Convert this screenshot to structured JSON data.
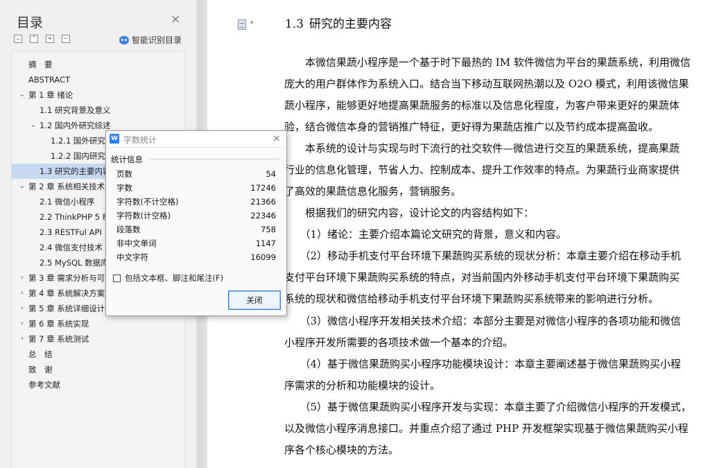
{
  "nav": {
    "title": "目录",
    "close_glyph": "×",
    "tool_glyphs": [
      "⌄",
      "⌃",
      "+",
      "−"
    ],
    "smart_toc_label": "智能识别目录",
    "items": [
      {
        "label": "摘　要",
        "level": 0,
        "expand": "",
        "selected": false
      },
      {
        "label": "ABSTRACT",
        "level": 0,
        "expand": "",
        "selected": false
      },
      {
        "label": "第 1 章  绪论",
        "level": 0,
        "expand": "open",
        "selected": false
      },
      {
        "label": "1.1  研究背景及意义",
        "level": 1,
        "expand": "",
        "selected": false
      },
      {
        "label": "1.2  国内外研究综述",
        "level": 1,
        "expand": "open",
        "selected": false
      },
      {
        "label": "1.2.1 国外研究现状",
        "level": 2,
        "expand": "",
        "selected": false
      },
      {
        "label": "1.2.2 国内研究现状",
        "level": 2,
        "expand": "",
        "selected": false
      },
      {
        "label": "1.3  研究的主要内容",
        "level": 1,
        "expand": "",
        "selected": true
      },
      {
        "label": "第 2 章  系统相关技术介绍",
        "level": 0,
        "expand": "open",
        "selected": false
      },
      {
        "label": "2.1  微信小程序",
        "level": 1,
        "expand": "",
        "selected": false
      },
      {
        "label": "2.2 ThinkPHP 5 框架",
        "level": 1,
        "expand": "",
        "selected": false
      },
      {
        "label": "2.3 RESTFul API",
        "level": 1,
        "expand": "",
        "selected": false
      },
      {
        "label": "2.4  微信支付技术",
        "level": 1,
        "expand": "",
        "selected": false
      },
      {
        "label": "2.5 MySQL 数据库",
        "level": 1,
        "expand": "",
        "selected": false
      },
      {
        "label": "第 3 章  需求分析与可行性分析",
        "level": 0,
        "expand": "closed",
        "selected": false
      },
      {
        "label": "第 4 章  系统解决方案",
        "level": 0,
        "expand": "closed",
        "selected": false
      },
      {
        "label": "第 5 章  系统详细设计",
        "level": 0,
        "expand": "closed",
        "selected": false
      },
      {
        "label": "第 6 章  系统实现",
        "level": 0,
        "expand": "closed",
        "selected": false
      },
      {
        "label": "第 7 章  系统测试",
        "level": 0,
        "expand": "closed",
        "selected": false
      },
      {
        "label": "总　结",
        "level": 0,
        "expand": "",
        "selected": false
      },
      {
        "label": "致　谢",
        "level": 0,
        "expand": "",
        "selected": false
      },
      {
        "label": "参考文献",
        "level": 0,
        "expand": "",
        "selected": false
      }
    ]
  },
  "document": {
    "heading_number": "1.3",
    "heading_text": "研究的主要内容",
    "lines": [
      "　　本微信果蔬小程序是一个基于时下最热的 IM 软件微信为平台的果蔬系统，利用微信",
      "庞大的用户群体作为系统入口。结合当下移动互联网热潮以及 O2O 模式，利用该微信果",
      "蔬小程序，能够更好地提高果蔬服务的标准以及信息化程度，为客户带来更好的果蔬体",
      "验，结合微信本身的营销推广特征，更好得为果蔬店推广以及节约成本提高盈收。",
      "　　本系统的设计与实现与时下流行的社交软件—微信进行交互的果蔬系统，提高果蔬",
      "行业的信息化管理，节省人力、控制成本、提升工作效率的特点。为果蔬行业商家提供",
      "了高效的果蔬信息化服务，营销服务。",
      "　　根据我们的研究内容，设计论文的内容结构如下：",
      "　　（1）绪论：主要介绍本篇论文研究的背景，意义和内容。",
      "　　（2）移动手机支付平台环境下果蔬购买系统的现状分析：本章主要介绍在移动手机",
      "支付平台环境下果蔬购买系统的特点，对当前国内外移动手机支付平台环境下果蔬购买",
      "系统的现状和微信给移动手机支付平台环境下果蔬购买系统带来的影响进行分析。",
      "　　（3）微信小程序开发相关技术介绍：本部分主要是对微信小程序的各项功能和微信",
      "小程序开发所需要的各项技术做一个基本的介绍。",
      "　　（4）基于微信果蔬购买小程序功能模块设计：本章主要阐述基于微信果蔬购买小程",
      "序需求的分析和功能模块的设计。",
      "　　（5）基于微信果蔬购买小程序开发与实现：本章主要了介绍微信小程序的开发模式，",
      "以及微信小程序消息接口。并重点介绍了通过 PHP 开发框架实现基于微信果蔬购买小程",
      "序各个核心模块的方法。"
    ]
  },
  "dialog": {
    "logo_glyph": "W",
    "title": "字数统计",
    "close_glyph": "×",
    "section_header": "统计信息",
    "stats": [
      {
        "label": "页数",
        "value": "54"
      },
      {
        "label": "字数",
        "value": "17246"
      },
      {
        "label": "字符数(不计空格)",
        "value": "21366"
      },
      {
        "label": "字符数(计空格)",
        "value": "22346"
      },
      {
        "label": "段落数",
        "value": "758"
      },
      {
        "label": "非中文单词",
        "value": "1147"
      },
      {
        "label": "中文字符",
        "value": "16099"
      }
    ],
    "checkbox_label": "包括文本框、脚注和尾注(F)",
    "close_button_label": "关闭"
  }
}
